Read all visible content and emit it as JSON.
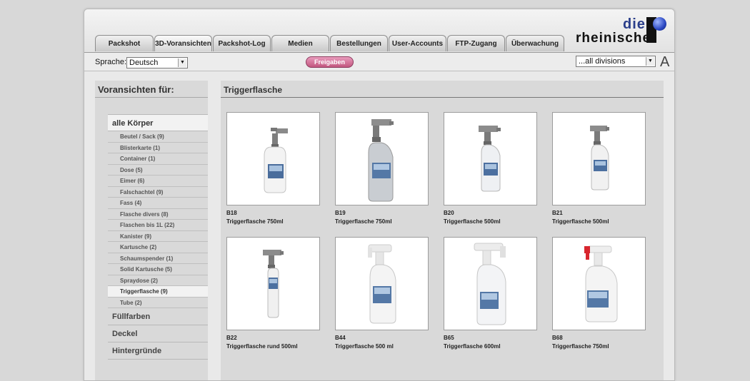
{
  "header": {
    "tabs": [
      {
        "label": "Packshot"
      },
      {
        "label": "3D-Voransichten"
      },
      {
        "label": "Packshot-Log"
      },
      {
        "label": "Medien"
      },
      {
        "label": "Bestellungen"
      },
      {
        "label": "User-Accounts"
      },
      {
        "label": "FTP-Zugang"
      },
      {
        "label": "Überwachung"
      }
    ],
    "logo": {
      "line1": "die",
      "line2": "rheinische"
    }
  },
  "toolbar": {
    "language_label": "Sprache:",
    "language_value": "Deutsch",
    "freigaben_label": "Freigaben",
    "division_value": "...all divisions",
    "font_size_label": "A"
  },
  "sidebar": {
    "title": "Voransichten für:",
    "main_category": "alle Körper",
    "subcategories": [
      {
        "label": "Beutel / Sack (9)"
      },
      {
        "label": "Blisterkarte (1)"
      },
      {
        "label": "Container (1)"
      },
      {
        "label": "Dose (5)"
      },
      {
        "label": "Eimer (6)"
      },
      {
        "label": "Falschachtel (9)"
      },
      {
        "label": "Fass (4)"
      },
      {
        "label": "Flasche divers (8)"
      },
      {
        "label": "Flaschen bis 1L (22)"
      },
      {
        "label": "Kanister (9)"
      },
      {
        "label": "Kartusche (2)"
      },
      {
        "label": "Schaumspender (1)"
      },
      {
        "label": "Solid Kartusche (5)"
      },
      {
        "label": "Spraydose (2)"
      },
      {
        "label": "Triggerflasche (9)"
      },
      {
        "label": "Tube (2)"
      }
    ],
    "groups": [
      {
        "label": "Füllfarben"
      },
      {
        "label": "Deckel"
      },
      {
        "label": "Hintergründe"
      }
    ]
  },
  "content": {
    "title": "Triggerflasche",
    "products": [
      {
        "code": "B18",
        "name": "Triggerflasche 750ml"
      },
      {
        "code": "B19",
        "name": "Triggerflasche 750ml"
      },
      {
        "code": "B20",
        "name": "Triggerflasche 500ml"
      },
      {
        "code": "B21",
        "name": "Triggerflasche 500ml"
      },
      {
        "code": "B22",
        "name": "Triggerflasche rund 500ml"
      },
      {
        "code": "B44",
        "name": "Triggerflasche 500 ml"
      },
      {
        "code": "B65",
        "name": "Triggerflasche 600ml"
      },
      {
        "code": "B68",
        "name": "Triggerflasche 750ml"
      }
    ]
  },
  "colors": {
    "freigaben_button": "#c2577f",
    "logo_blue": "#2a3e8a",
    "trigger_red": "#d8262e"
  }
}
